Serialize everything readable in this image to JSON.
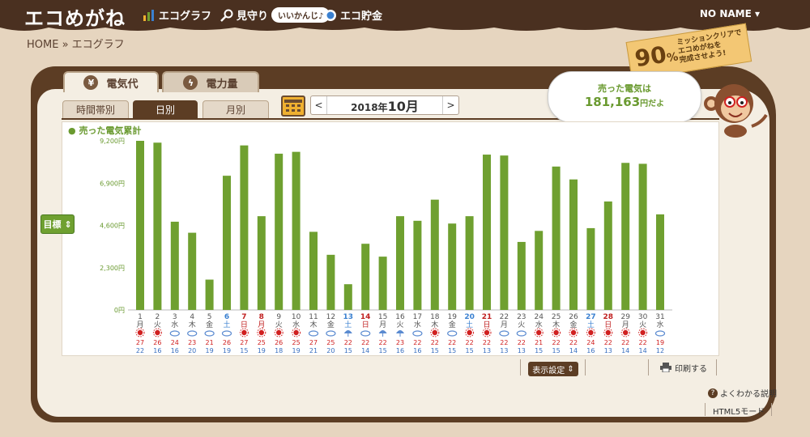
{
  "header": {
    "logo": "エコめがね",
    "nav": [
      {
        "label": "エコグラフ",
        "icon": "bar-chart-icon"
      },
      {
        "label": "見守り",
        "icon": "magnifier-icon"
      },
      {
        "label": "エコ貯金",
        "icon": "coin-icon"
      }
    ],
    "pill": "いいかんじ♪",
    "user": "NO NAME"
  },
  "breadcrumb": "HOME » エコグラフ",
  "mission": {
    "percent": "90",
    "percent_unit": "%",
    "message": [
      "ミッションクリアで",
      "エコめがねを",
      "完成させよう!"
    ]
  },
  "tabs": [
    {
      "label": "電気代",
      "icon": "yen-icon",
      "active": true
    },
    {
      "label": "電力量",
      "icon": "lightning-icon",
      "active": false
    }
  ],
  "subtabs": [
    {
      "label": "時間帯別",
      "active": false
    },
    {
      "label": "日別",
      "active": true
    },
    {
      "label": "月別",
      "active": false
    }
  ],
  "month_nav": {
    "prev": "<",
    "next": ">",
    "year": "2018年",
    "month": "10月"
  },
  "sold": {
    "line1": "売った電気は",
    "amount": "181,163",
    "unit": "円だよ"
  },
  "target_button": "目標",
  "display_settings": "表示設定",
  "print": "印刷する",
  "help": "よくわかる説明",
  "html5": "HTML5モード",
  "colors": {
    "bar": "#6fa030",
    "header": "#4a3020",
    "saturday": "#3a80d0",
    "sunday": "#c02020"
  },
  "chart_data": {
    "type": "bar",
    "legend": "売った電気累計",
    "yticks": [
      "0円",
      "2,300円",
      "4,600円",
      "6,900円",
      "9,200円"
    ],
    "ylim": [
      0,
      9200
    ],
    "days": [
      "1",
      "2",
      "3",
      "4",
      "5",
      "6",
      "7",
      "8",
      "9",
      "10",
      "11",
      "12",
      "13",
      "14",
      "15",
      "16",
      "17",
      "18",
      "19",
      "20",
      "21",
      "22",
      "23",
      "24",
      "25",
      "26",
      "27",
      "28",
      "29",
      "30",
      "31"
    ],
    "weekdays": [
      "月",
      "火",
      "水",
      "木",
      "金",
      "土",
      "日",
      "月",
      "火",
      "水",
      "木",
      "金",
      "土",
      "日",
      "月",
      "火",
      "水",
      "木",
      "金",
      "土",
      "日",
      "月",
      "火",
      "水",
      "木",
      "金",
      "土",
      "日",
      "月",
      "火",
      "水"
    ],
    "day_kind": [
      "w",
      "w",
      "w",
      "w",
      "w",
      "sat",
      "sun",
      "sun",
      "w",
      "w",
      "w",
      "w",
      "sat",
      "sun",
      "w",
      "w",
      "w",
      "w",
      "w",
      "sat",
      "sun",
      "w",
      "w",
      "w",
      "w",
      "w",
      "sat",
      "sun",
      "w",
      "w",
      "w"
    ],
    "values": [
      9200,
      9100,
      4800,
      4200,
      1650,
      7300,
      8950,
      5100,
      8500,
      8600,
      4250,
      3000,
      1400,
      3600,
      2900,
      5100,
      4850,
      6000,
      4700,
      5100,
      8450,
      8400,
      3700,
      4300,
      7800,
      7100,
      4450,
      5900,
      8000,
      7950,
      5200
    ],
    "weather": [
      "sun",
      "sun",
      "cloud",
      "cloud",
      "cloud",
      "cloud",
      "sun",
      "sun",
      "sun",
      "sun",
      "cloud",
      "cloud",
      "umbrella",
      "cloud",
      "umbrella",
      "umbrella",
      "cloud",
      "sun",
      "cloud",
      "sun",
      "sun",
      "cloud",
      "cloud",
      "sun",
      "sun",
      "sun",
      "sun",
      "sun",
      "sun",
      "sun",
      "cloud"
    ],
    "temp_high": [
      "27",
      "26",
      "24",
      "23",
      "21",
      "26",
      "27",
      "25",
      "26",
      "25",
      "27",
      "25",
      "22",
      "22",
      "22",
      "23",
      "22",
      "22",
      "22",
      "22",
      "22",
      "22",
      "22",
      "21",
      "22",
      "22",
      "24",
      "22",
      "22",
      "22",
      "19"
    ],
    "temp_low": [
      "22",
      "16",
      "16",
      "20",
      "19",
      "19",
      "15",
      "19",
      "18",
      "19",
      "21",
      "20",
      "15",
      "14",
      "15",
      "16",
      "16",
      "15",
      "15",
      "15",
      "13",
      "13",
      "13",
      "15",
      "15",
      "14",
      "16",
      "13",
      "14",
      "14",
      "12"
    ]
  }
}
